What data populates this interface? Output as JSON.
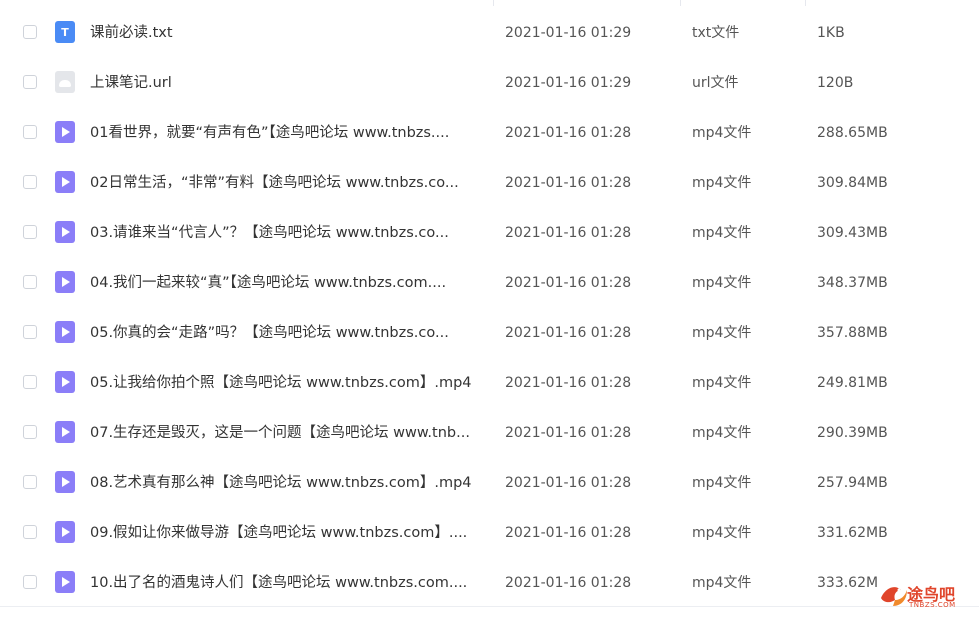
{
  "files": [
    {
      "name": "课前必读.txt",
      "date": "2021-01-16 01:29",
      "type": "txt文件",
      "size": "1KB",
      "icon": "text-file-icon",
      "kind": "txt"
    },
    {
      "name": "上课笔记.url",
      "date": "2021-01-16 01:29",
      "type": "url文件",
      "size": "120B",
      "icon": "link-file-icon",
      "kind": "url"
    },
    {
      "name": "01看世界，就要“有声有色”【途鸟吧论坛 www.tnbzs....",
      "date": "2021-01-16 01:28",
      "type": "mp4文件",
      "size": "288.65MB",
      "icon": "video-file-icon",
      "kind": "mp4"
    },
    {
      "name": "02日常生活，“非常”有料【途鸟吧论坛 www.tnbzs.co...",
      "date": "2021-01-16 01:28",
      "type": "mp4文件",
      "size": "309.84MB",
      "icon": "video-file-icon",
      "kind": "mp4"
    },
    {
      "name": "03.请谁来当“代言人”？【途鸟吧论坛 www.tnbzs.co...",
      "date": "2021-01-16 01:28",
      "type": "mp4文件",
      "size": "309.43MB",
      "icon": "video-file-icon",
      "kind": "mp4"
    },
    {
      "name": "04.我们一起来较“真”【途鸟吧论坛 www.tnbzs.com....",
      "date": "2021-01-16 01:28",
      "type": "mp4文件",
      "size": "348.37MB",
      "icon": "video-file-icon",
      "kind": "mp4"
    },
    {
      "name": "05.你真的会“走路”吗？【途鸟吧论坛 www.tnbzs.co...",
      "date": "2021-01-16 01:28",
      "type": "mp4文件",
      "size": "357.88MB",
      "icon": "video-file-icon",
      "kind": "mp4"
    },
    {
      "name": "05.让我给你拍个照【途鸟吧论坛 www.tnbzs.com】.mp4",
      "date": "2021-01-16 01:28",
      "type": "mp4文件",
      "size": "249.81MB",
      "icon": "video-file-icon",
      "kind": "mp4"
    },
    {
      "name": "07.生存还是毁灭，这是一个问题【途鸟吧论坛 www.tnb...",
      "date": "2021-01-16 01:28",
      "type": "mp4文件",
      "size": "290.39MB",
      "icon": "video-file-icon",
      "kind": "mp4"
    },
    {
      "name": "08.艺术真有那么神【途鸟吧论坛 www.tnbzs.com】.mp4",
      "date": "2021-01-16 01:28",
      "type": "mp4文件",
      "size": "257.94MB",
      "icon": "video-file-icon",
      "kind": "mp4"
    },
    {
      "name": "09.假如让你来做导游【途鸟吧论坛 www.tnbzs.com】....",
      "date": "2021-01-16 01:28",
      "type": "mp4文件",
      "size": "331.62MB",
      "icon": "video-file-icon",
      "kind": "mp4"
    },
    {
      "name": "10.出了名的酒鬼诗人们【途鸟吧论坛 www.tnbzs.com....",
      "date": "2021-01-16 01:28",
      "type": "mp4文件",
      "size": "333.62M",
      "icon": "video-file-icon",
      "kind": "mp4"
    }
  ],
  "txt_icon_glyph": "T",
  "watermark": {
    "title": "途鸟吧",
    "subtitle": "TNBZS.COM"
  },
  "colors": {
    "txt_icon": "#4a8bf5",
    "mp4_icon": "#8b7ef8",
    "url_icon": "#e4e6ea",
    "watermark": "#e0452b"
  }
}
